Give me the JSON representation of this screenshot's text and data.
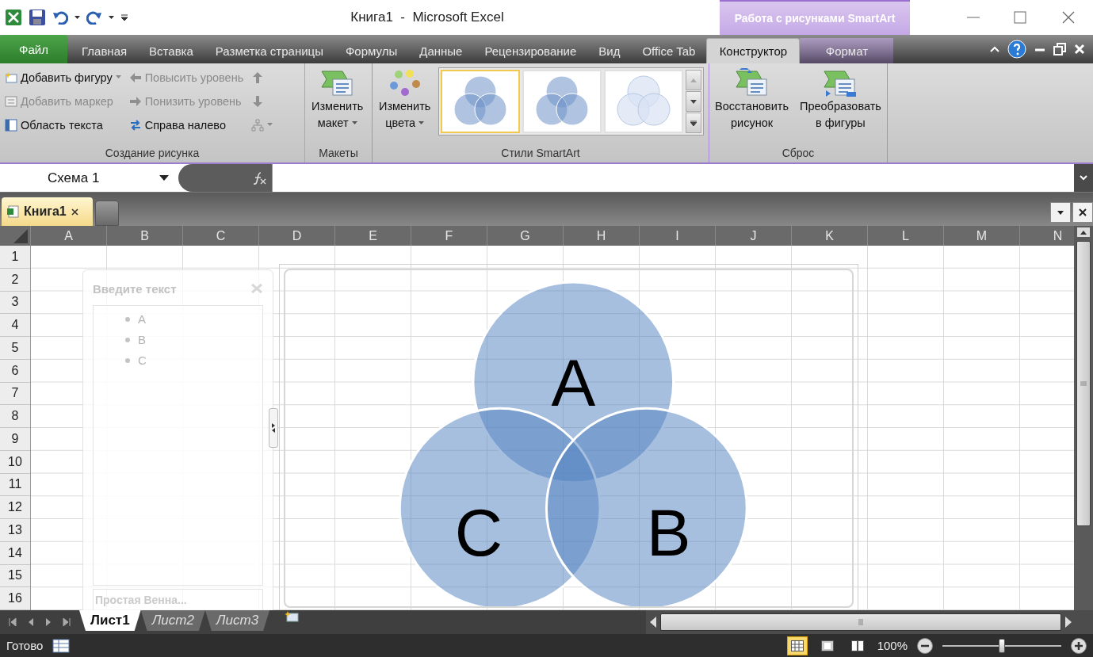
{
  "window": {
    "title": "Книга1  -  Microsoft Excel",
    "context_title": "Работа с рисунками SmartArt"
  },
  "ribbon_tabs": [
    {
      "label": "Файл",
      "kind": "file",
      "selected": false
    },
    {
      "label": "Главная",
      "kind": "normal",
      "selected": false
    },
    {
      "label": "Вставка",
      "kind": "normal",
      "selected": false
    },
    {
      "label": "Разметка страницы",
      "kind": "normal",
      "selected": false
    },
    {
      "label": "Формулы",
      "kind": "normal",
      "selected": false
    },
    {
      "label": "Данные",
      "kind": "normal",
      "selected": false
    },
    {
      "label": "Рецензирование",
      "kind": "normal",
      "selected": false
    },
    {
      "label": "Вид",
      "kind": "normal",
      "selected": false
    },
    {
      "label": "Office Tab",
      "kind": "normal",
      "selected": false
    },
    {
      "label": "Конструктор",
      "kind": "context",
      "selected": true
    },
    {
      "label": "Формат",
      "kind": "context",
      "selected": false
    }
  ],
  "ribbon_groups": [
    {
      "label": "Создание рисунка",
      "kind": "commands",
      "columns": [
        [
          {
            "label": "Добавить фигуру",
            "disabled": false,
            "dropdown": true
          },
          {
            "label": "Добавить маркер",
            "disabled": true,
            "dropdown": false
          },
          {
            "label": "Область текста",
            "disabled": false,
            "dropdown": false
          }
        ],
        [
          {
            "label": "Повысить уровень",
            "disabled": true,
            "dropdown": false
          },
          {
            "label": "Понизить уровень",
            "disabled": true,
            "dropdown": false
          },
          {
            "label": "Справа налево",
            "disabled": false,
            "dropdown": false
          }
        ],
        [
          {
            "disabled": true,
            "dropdown": false
          },
          {
            "disabled": true,
            "dropdown": false
          },
          {
            "disabled": true,
            "dropdown": true
          }
        ]
      ]
    },
    {
      "label": "Макеты",
      "kind": "large",
      "buttons": [
        {
          "lines": [
            "Изменить",
            "макет"
          ],
          "dropdown": true
        }
      ]
    },
    {
      "label": "Стили SmartArt",
      "kind": "gallery",
      "buttons": [
        {
          "lines": [
            "Изменить",
            "цвета"
          ],
          "dropdown": true
        }
      ],
      "styles": [
        {
          "kind": "flat",
          "selected": true
        },
        {
          "kind": "flat",
          "selected": false
        },
        {
          "kind": "subtle",
          "selected": false
        }
      ]
    },
    {
      "label": "Сброс",
      "kind": "large",
      "buttons": [
        {
          "lines": [
            "Восстановить",
            "рисунок"
          ],
          "dropdown": false
        },
        {
          "lines": [
            "Преобразовать",
            "в фигуры"
          ],
          "dropdown": false
        }
      ]
    }
  ],
  "name_box": {
    "value": "Схема 1"
  },
  "workbook_tabs": [
    {
      "label": "Книга1",
      "selected": true
    }
  ],
  "columns": [
    "A",
    "B",
    "C",
    "D",
    "E",
    "F",
    "G",
    "H",
    "I",
    "J",
    "K",
    "L",
    "M",
    "N"
  ],
  "rows": [
    "1",
    "2",
    "3",
    "4",
    "5",
    "6",
    "7",
    "8",
    "9",
    "10",
    "11",
    "12",
    "13",
    "14",
    "15",
    "16"
  ],
  "text_pane": {
    "title": "Введите текст",
    "items": [
      "A",
      "B",
      "C"
    ],
    "footer": "Простая Венна..."
  },
  "smartart": {
    "circles": [
      {
        "label": "A"
      },
      {
        "label": "C"
      },
      {
        "label": "B"
      }
    ]
  },
  "sheet_tabs": [
    {
      "label": "Лист1",
      "selected": true
    },
    {
      "label": "Лист2",
      "selected": false
    },
    {
      "label": "Лист3",
      "selected": false
    }
  ],
  "status_bar": {
    "text": "Готово",
    "views": [
      {
        "selected": true
      },
      {
        "selected": false
      },
      {
        "selected": false
      }
    ],
    "zoom": "100%",
    "zoom_slider": {
      "level": 0.5
    }
  }
}
